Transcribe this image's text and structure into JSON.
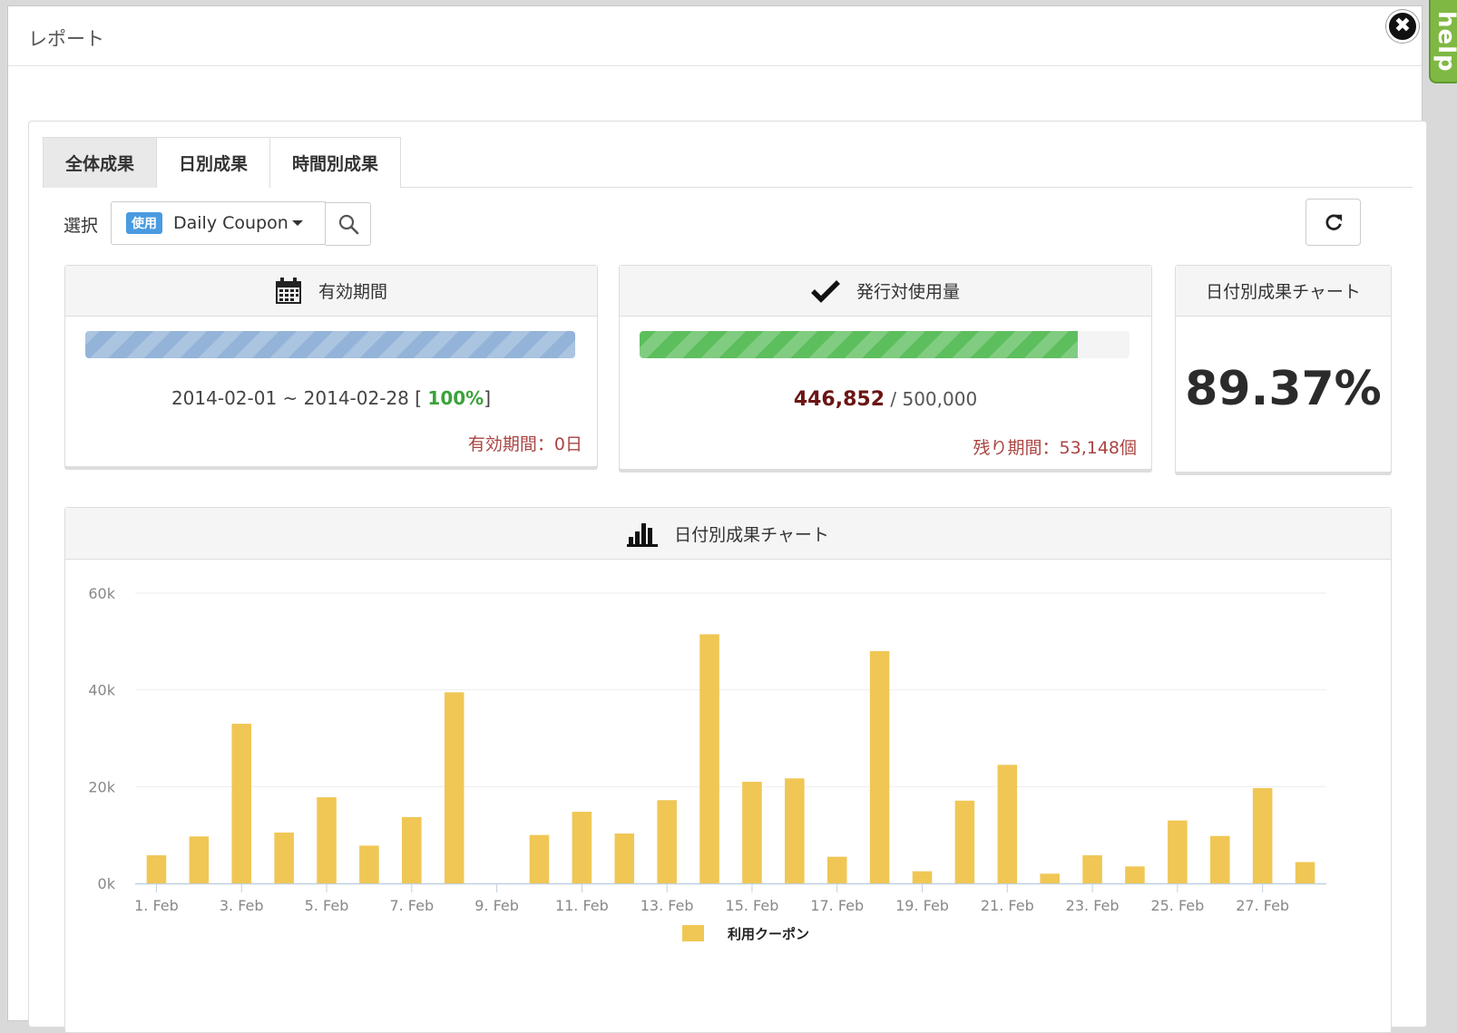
{
  "modal": {
    "title": "レポート",
    "close_label": "✖",
    "help_label": "help"
  },
  "tabs": [
    {
      "label": "全体成果",
      "active": true
    },
    {
      "label": "日別成果",
      "active": false
    },
    {
      "label": "時間別成果",
      "active": false
    }
  ],
  "selector": {
    "label": "選択",
    "badge": "使用",
    "value": "Daily Coupon"
  },
  "cards": {
    "period": {
      "title": "有効期間",
      "range": "2014-02-01 ~ 2014-02-28",
      "percent": "100%",
      "progress_fraction": 1.0,
      "remaining": "有効期間：0日"
    },
    "usage": {
      "title": "発行対使用量",
      "used": "446,852",
      "total": "/ 500,000",
      "progress_fraction": 0.8937,
      "remaining": "残り期間：53,148個"
    },
    "rate": {
      "title": "日付別成果チャート",
      "value": "89.37%"
    }
  },
  "chart_panel": {
    "title": "日付別成果チャート"
  },
  "colors": {
    "bar": "#f0c755",
    "progress_blue": "#93b4d8",
    "progress_green": "#5dbe5d"
  },
  "chart_data": {
    "type": "bar",
    "categories": [
      "1. Feb",
      "2. Feb",
      "3. Feb",
      "4. Feb",
      "5. Feb",
      "6. Feb",
      "7. Feb",
      "8. Feb",
      "9. Feb",
      "10. Feb",
      "11. Feb",
      "12. Feb",
      "13. Feb",
      "14. Feb",
      "15. Feb",
      "16. Feb",
      "17. Feb",
      "18. Feb",
      "19. Feb",
      "20. Feb",
      "21. Feb",
      "22. Feb",
      "23. Feb",
      "24. Feb",
      "25. Feb",
      "26. Feb",
      "27. Feb",
      "28. Feb"
    ],
    "tick_labels": [
      "1. Feb",
      "3. Feb",
      "5. Feb",
      "7. Feb",
      "9. Feb",
      "11. Feb",
      "13. Feb",
      "15. Feb",
      "17. Feb",
      "19. Feb",
      "21. Feb",
      "23. Feb",
      "25. Feb",
      "27. Feb"
    ],
    "series": [
      {
        "name": "利用クーポン",
        "values": [
          5800,
          9700,
          33000,
          10500,
          17800,
          7800,
          13700,
          39500,
          0,
          10000,
          14800,
          10300,
          17200,
          51500,
          21000,
          21700,
          5500,
          48000,
          2500,
          17100,
          24500,
          2000,
          5800,
          3500,
          13000,
          9800,
          19700,
          4400
        ]
      }
    ],
    "y_ticks": [
      "0k",
      "20k",
      "40k",
      "60k"
    ],
    "ylim": [
      0,
      60000
    ],
    "grid": true,
    "legend": "bottom-center"
  }
}
